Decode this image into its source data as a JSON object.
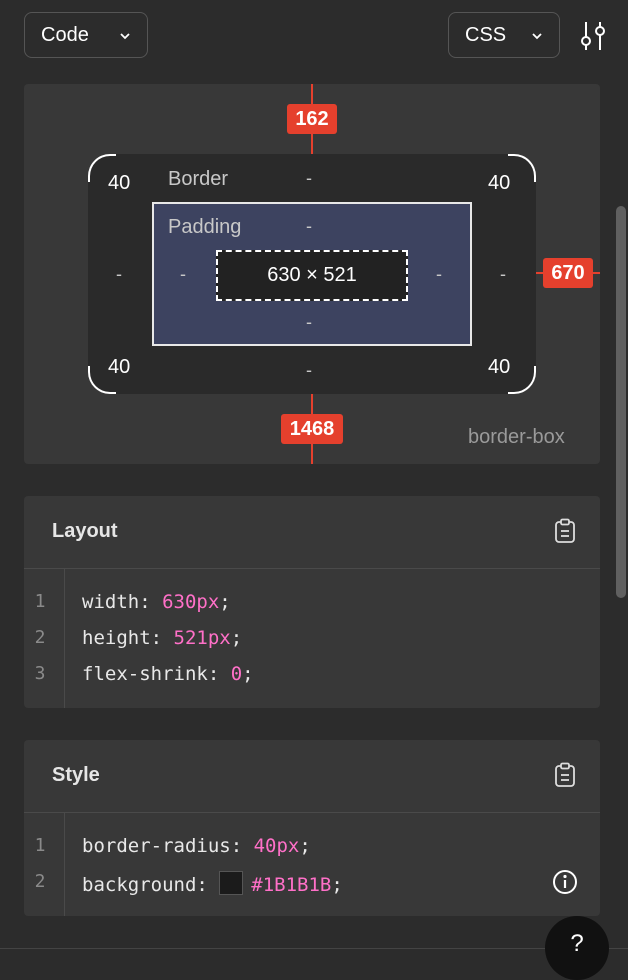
{
  "toolbar": {
    "mode_label": "Code",
    "language_label": "CSS"
  },
  "box_model": {
    "top_offset": "162",
    "right_offset": "670",
    "bottom_offset": "1468",
    "border_label": "Border",
    "padding_label": "Padding",
    "radius_top_left": "40",
    "radius_top_right": "40",
    "radius_bottom_left": "40",
    "radius_bottom_right": "40",
    "border_top": "-",
    "border_left": "-",
    "border_right": "-",
    "border_bottom": "-",
    "padding_top": "-",
    "padding_left": "-",
    "padding_right": "-",
    "padding_bottom": "-",
    "content_size": "630 × 521",
    "box_sizing": "border-box"
  },
  "layout_section": {
    "title": "Layout",
    "lines": [
      {
        "num": "1",
        "prop": "width: ",
        "value": "630px",
        "end": ";"
      },
      {
        "num": "2",
        "prop": "height: ",
        "value": "521px",
        "end": ";"
      },
      {
        "num": "3",
        "prop": "flex-shrink: ",
        "value": "0",
        "end": ";"
      }
    ]
  },
  "style_section": {
    "title": "Style",
    "lines": [
      {
        "num": "1",
        "prop": "border-radius: ",
        "value": "40px",
        "end": ";"
      },
      {
        "num": "2",
        "prop": "background: ",
        "value": "#1B1B1B",
        "end": ";"
      }
    ]
  },
  "help": {
    "label": "?"
  },
  "colors": {
    "accent_red": "#e5402d",
    "value_pink": "#ff70c8",
    "swatch": "#1B1B1B",
    "padding_fill": "#3d4360"
  },
  "icons": [
    "chevron-down-icon",
    "sliders-icon",
    "clipboard-icon",
    "info-icon"
  ]
}
